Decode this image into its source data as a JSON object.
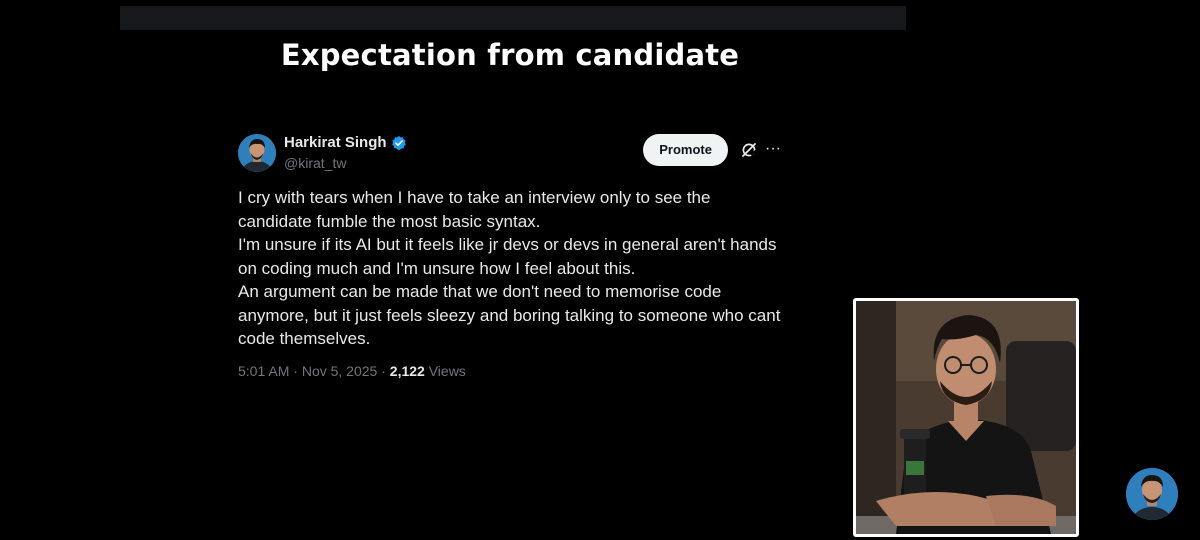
{
  "slide": {
    "title": "Expectation from candidate"
  },
  "tweet": {
    "author_name": "Harkirat Singh",
    "author_handle": "@kirat_tw",
    "verified": true,
    "promote_label": "Promote",
    "more_label": "···",
    "text_lines": [
      "I cry with tears when I have to take an interview only to see the candidate fumble the most basic syntax.",
      "I'm unsure if its AI but it feels like jr devs or devs in general aren't hands on coding much and I'm unsure how I feel about this.",
      "An argument can be made that we don't need to memorise code anymore, but it just feels sleezy and boring talking to someone who cant code themselves."
    ],
    "time": "5:01 AM",
    "date": "Nov 5, 2025",
    "separator": "·",
    "views_count": "2,122",
    "views_label": "Views"
  },
  "icons": {
    "verified": "verified-badge-icon",
    "grok": "grok-icon",
    "more": "more-icon"
  },
  "colors": {
    "background": "#000000",
    "text_primary": "#e7e9ea",
    "text_secondary": "#71767b",
    "verified_blue": "#1d9bf0",
    "promote_bg": "#eff3f4"
  }
}
